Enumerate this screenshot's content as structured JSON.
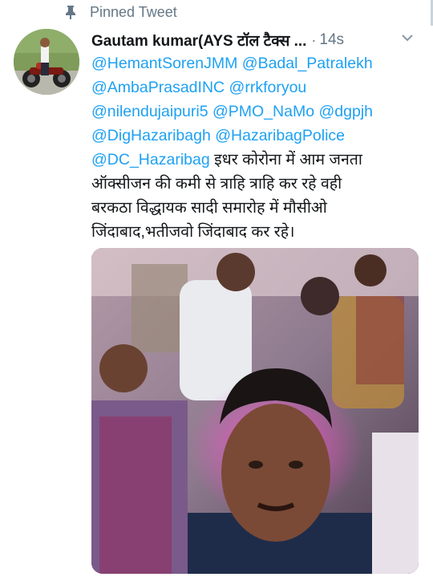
{
  "pinned": {
    "label": "Pinned Tweet",
    "icon": "pin-icon"
  },
  "tweet": {
    "author": "Gautam kumar(AYS टॉल टैक्स ...",
    "dot": "·",
    "time": "14s",
    "mentions_line1": [
      "@HemantSorenJMM",
      "@Badal_Patralekh"
    ],
    "mentions_line2": [
      "@AmbaPrasadINC",
      "@rrkforyou"
    ],
    "mentions_line3": [
      "@nilendujaipuri5",
      "@PMO_NaMo",
      "@dgpjh"
    ],
    "mentions_line4": [
      "@DigHazaribagh",
      "@HazaribagPolice"
    ],
    "mention_line5": "@DC_Hazaribag",
    "text_line5": "इधर कोरोना में आम जनता",
    "text_line6": "ऑक्सीजन की कमी से त्राहि त्राहि कर रहे वही",
    "text_line7": "बरकठा विद्धायक सादी समारोह में मौसीओ",
    "text_line8": "जिंदाबाद,भतीजवो जिंदाबाद कर रहे।"
  },
  "colors": {
    "mention": "#1da1f2",
    "secondary_text": "#657786",
    "primary_text": "#14171a"
  },
  "icons": [
    "pin-icon",
    "chevron-down-icon",
    "avatar"
  ]
}
